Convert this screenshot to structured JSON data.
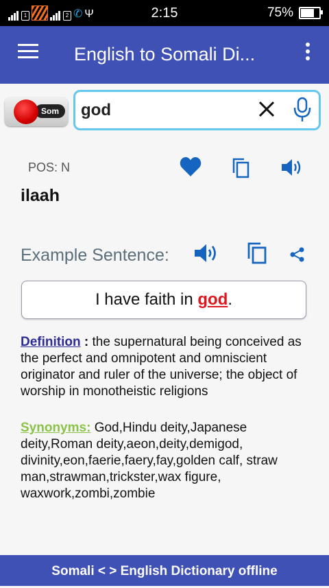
{
  "status_bar": {
    "time": "2:15",
    "battery": "75%"
  },
  "app_bar": {
    "title": "English to Somali Di..."
  },
  "language_toggle": {
    "label": "Som"
  },
  "search": {
    "value": "god"
  },
  "result": {
    "pos": "POS: N",
    "translation": "ilaah",
    "example_label": "Example Sentence:",
    "sentence_before": "I have faith in ",
    "sentence_word": "god",
    "sentence_after": ".",
    "definition_label": "Definition",
    "definition_sep": " : ",
    "definition_text": "the supernatural being conceived as the perfect and omnipotent and omniscient originator and ruler of the universe; the object of worship in monotheistic religions",
    "synonyms_label": "Synonyms:",
    "synonyms_text": " God,Hindu deity,Japanese deity,Roman deity,aeon,deity,demigod, divinity,eon,faerie,faery,fay,golden calf, straw man,strawman,trickster,wax figure, waxwork,zombi,zombie"
  },
  "footer": {
    "text": "Somali < > English Dictionary offline"
  },
  "colors": {
    "primary": "#3f51b5",
    "icon_blue": "#1565c0",
    "highlight_red": "#e0161d",
    "synonym_green": "#8bc34a",
    "definition_navy": "#2c2c94",
    "search_border": "#64c8ee"
  }
}
